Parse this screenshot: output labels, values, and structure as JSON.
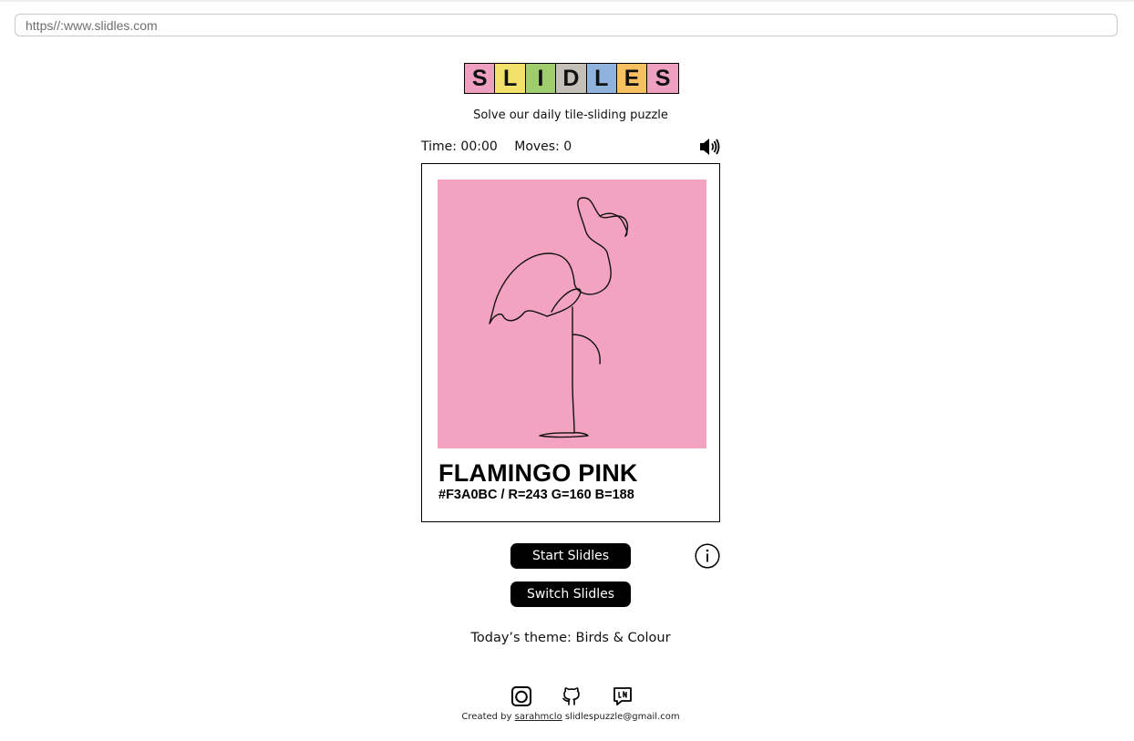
{
  "browser": {
    "url": "https//:www.slidles.com"
  },
  "logo": {
    "letters": [
      "S",
      "L",
      "I",
      "D",
      "L",
      "E",
      "S"
    ],
    "colors": [
      "#ef9fc0",
      "#f2e16a",
      "#9fcd6e",
      "#c4c0b8",
      "#8fb3dd",
      "#f7c060",
      "#ef9fc0"
    ]
  },
  "subtitle": "Solve our daily tile-sliding puzzle",
  "stats": {
    "time": "Time: 00:00",
    "moves": "Moves: 0"
  },
  "card": {
    "swatch_color": "#f3a3c0",
    "name": "FLAMINGO PINK",
    "code": "#F3A0BC / R=243 G=160 B=188"
  },
  "buttons": {
    "start": "Start Slidles",
    "switch": "Switch Slidles"
  },
  "theme": "Today’s theme: Birds & Colour",
  "footer": {
    "created_by": "Created by",
    "author": "sarahmclo",
    "email": "slidlespuzzle@gmail.com"
  },
  "icons": [
    "speaker-icon",
    "info-icon",
    "instagram-icon",
    "github-icon",
    "linkedin-icon",
    "flamingo-drawing"
  ]
}
